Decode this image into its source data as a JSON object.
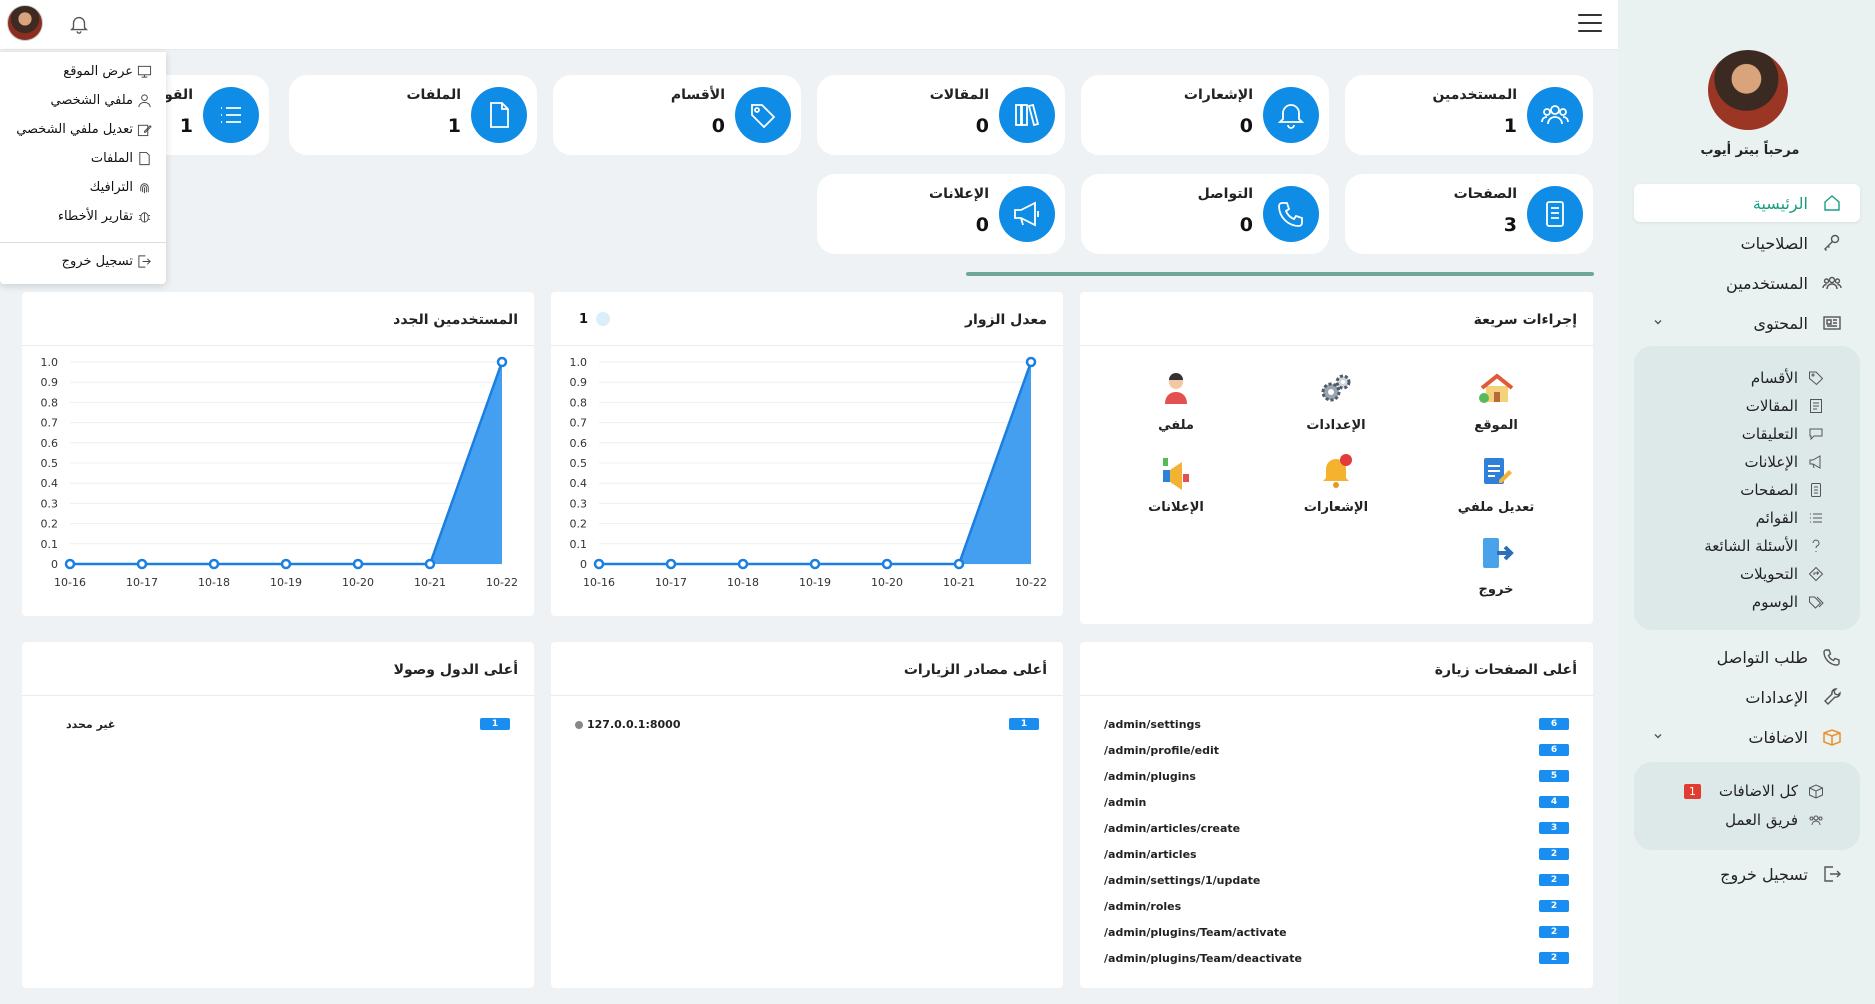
{
  "user": {
    "welcome": "مرحباً بيتر أيوب"
  },
  "dropdown": [
    "عرض الموقع",
    "ملفي الشخصي",
    "تعديل ملفي الشخصي",
    "الملفات",
    "الترافيك",
    "تقارير الأخطاء",
    "تسجيل خروج"
  ],
  "sidebar": {
    "main": [
      {
        "label": "الرئيسية",
        "icon": "home-icon",
        "active": true
      },
      {
        "label": "الصلاحيات",
        "icon": "key-icon"
      },
      {
        "label": "المستخدمين",
        "icon": "users-icon"
      },
      {
        "label": "المحتوى",
        "icon": "newspaper-icon",
        "expandable": true
      }
    ],
    "content_sub": [
      {
        "label": "الأقسام",
        "icon": "tag-icon"
      },
      {
        "label": "المقالات",
        "icon": "article-icon"
      },
      {
        "label": "التعليقات",
        "icon": "comments-icon"
      },
      {
        "label": "الإعلانات",
        "icon": "megaphone-icon"
      },
      {
        "label": "الصفحات",
        "icon": "pages-icon"
      },
      {
        "label": "القوائم",
        "icon": "list-icon"
      },
      {
        "label": "الأسئلة الشائعة",
        "icon": "question-icon"
      },
      {
        "label": "التحويلات",
        "icon": "redirect-icon"
      },
      {
        "label": "الوسوم",
        "icon": "tags-icon"
      }
    ],
    "middle": [
      {
        "label": "طلب التواصل",
        "icon": "phone-icon"
      },
      {
        "label": "الإعدادات",
        "icon": "wrench-icon"
      },
      {
        "label": "الاضافات",
        "icon": "box-icon",
        "expandable": true
      }
    ],
    "plugins_sub": [
      {
        "label": "كل الاضافات",
        "icon": "box-icon",
        "badge": "1"
      },
      {
        "label": "فريق العمل",
        "icon": "users-icon"
      }
    ],
    "logout": "تسجيل خروج"
  },
  "stats": [
    {
      "title": "المستخدمين",
      "value": "1",
      "icon": "users-icon"
    },
    {
      "title": "الإشعارات",
      "value": "0",
      "icon": "bell-icon"
    },
    {
      "title": "المقالات",
      "value": "0",
      "icon": "books-icon"
    },
    {
      "title": "الأقسام",
      "value": "0",
      "icon": "tag-icon"
    },
    {
      "title": "الملفات",
      "value": "1",
      "icon": "file-icon"
    },
    {
      "title": "القوائم",
      "value": "1",
      "icon": "list-icon"
    },
    {
      "title": "الصفحات",
      "value": "3",
      "icon": "pages-icon"
    },
    {
      "title": "التواصل",
      "value": "0",
      "icon": "phone-icon"
    },
    {
      "title": "الإعلانات",
      "value": "0",
      "icon": "megaphone-icon"
    }
  ],
  "quick_actions": {
    "title": "إجراءات سريعة",
    "items": [
      {
        "label": "الموقع",
        "icon": "house-icon"
      },
      {
        "label": "الإعدادات",
        "icon": "gears-icon"
      },
      {
        "label": "ملفي",
        "icon": "person-icon"
      },
      {
        "label": "تعديل ملفي",
        "icon": "edit-profile-icon"
      },
      {
        "label": "الإشعارات",
        "icon": "bell-icon"
      },
      {
        "label": "الإعلانات",
        "icon": "ads-icon"
      },
      {
        "label": "خروج",
        "icon": "exit-icon"
      }
    ]
  },
  "visitors_panel": {
    "title": "معدل الزوار",
    "legend_value": "1"
  },
  "newusers_panel": {
    "title": "المستخدمين الجدد"
  },
  "chart_data": [
    {
      "type": "area",
      "title": "معدل الزوار",
      "x": [
        "10-16",
        "10-17",
        "10-18",
        "10-19",
        "10-20",
        "10-21",
        "10-22"
      ],
      "series": [
        {
          "name": "1",
          "values": [
            0,
            0,
            0,
            0,
            0,
            0,
            1
          ]
        }
      ],
      "ylim": [
        0,
        1
      ],
      "yticks": [
        "0",
        "0.1",
        "0.2",
        "0.3",
        "0.4",
        "0.5",
        "0.6",
        "0.7",
        "0.8",
        "0.9",
        "1.0"
      ],
      "color": "#3b9af0"
    },
    {
      "type": "area",
      "title": "المستخدمين الجدد",
      "x": [
        "10-16",
        "10-17",
        "10-18",
        "10-19",
        "10-20",
        "10-21",
        "10-22"
      ],
      "series": [
        {
          "values": [
            0,
            0,
            0,
            0,
            0,
            0,
            1
          ]
        }
      ],
      "ylim": [
        0,
        1
      ],
      "yticks": [
        "0",
        "0.1",
        "0.2",
        "0.3",
        "0.4",
        "0.5",
        "0.6",
        "0.7",
        "0.8",
        "0.9",
        "1.0"
      ],
      "color": "#3b9af0"
    }
  ],
  "top_pages": {
    "title": "أعلى الصفحات زيارة",
    "rows": [
      {
        "path": "/admin/settings",
        "count": "6"
      },
      {
        "path": "/admin/profile/edit",
        "count": "6"
      },
      {
        "path": "/admin/plugins",
        "count": "5"
      },
      {
        "path": "/admin",
        "count": "4"
      },
      {
        "path": "/admin/articles/create",
        "count": "3"
      },
      {
        "path": "/admin/articles",
        "count": "2"
      },
      {
        "path": "/admin/settings/1/update",
        "count": "2"
      },
      {
        "path": "/admin/roles",
        "count": "2"
      },
      {
        "path": "/admin/plugins/Team/activate",
        "count": "2"
      },
      {
        "path": "/admin/plugins/Team/deactivate",
        "count": "2"
      }
    ]
  },
  "top_sources": {
    "title": "أعلى مصادر الزيارات",
    "rows": [
      {
        "source": "127.0.0.1:8000",
        "count": "1"
      }
    ]
  },
  "top_countries": {
    "title": "أعلى الدول وصولا",
    "rows": [
      {
        "country": "غير محدد",
        "count": "1"
      }
    ]
  },
  "colors": {
    "accent": "#0f8ce6",
    "sidebar_active": "#1b9e7f",
    "bar": "#1a8ef0"
  }
}
